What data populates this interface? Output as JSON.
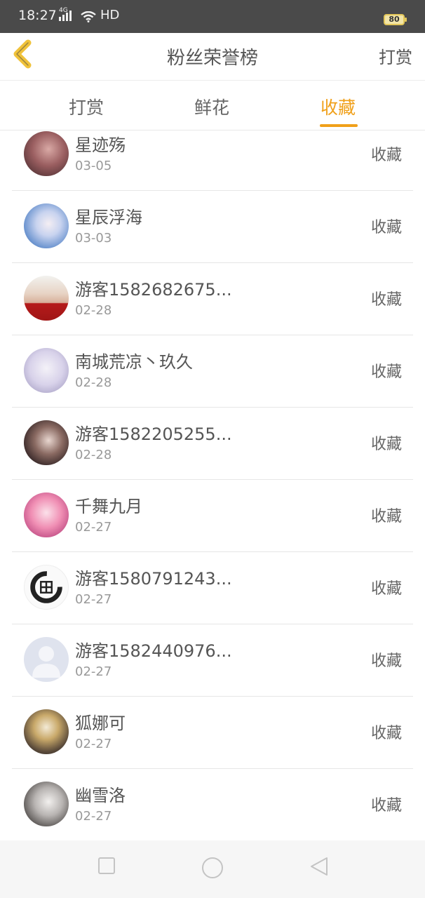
{
  "status_bar": {
    "time": "18:27",
    "network": "4G",
    "hd": "HD",
    "battery": "80"
  },
  "header": {
    "title": "粉丝荣誉榜",
    "action": "打赏"
  },
  "tabs": [
    {
      "label": "打赏",
      "active": false
    },
    {
      "label": "鲜花",
      "active": false
    },
    {
      "label": "收藏",
      "active": true
    }
  ],
  "list": [
    {
      "name": "星迹殇",
      "date": "03-05",
      "action": "收藏",
      "avatar": "portrait-rose"
    },
    {
      "name": "星辰浮海",
      "date": "03-03",
      "action": "收藏",
      "avatar": "portrait-blue"
    },
    {
      "name": "游客1582682675...",
      "date": "02-28",
      "action": "收藏",
      "avatar": "portrait-flag"
    },
    {
      "name": "南城荒凉丶玖久",
      "date": "02-28",
      "action": "收藏",
      "avatar": "portrait-lavender"
    },
    {
      "name": "游客1582205255...",
      "date": "02-28",
      "action": "收藏",
      "avatar": "portrait-dark"
    },
    {
      "name": "千舞九月",
      "date": "02-27",
      "action": "收藏",
      "avatar": "portrait-pink"
    },
    {
      "name": "游客1580791243...",
      "date": "02-27",
      "action": "收藏",
      "avatar": "portrait-ink"
    },
    {
      "name": "游客1582440976...",
      "date": "02-27",
      "action": "收藏",
      "avatar": "default-avatar"
    },
    {
      "name": "狐娜可",
      "date": "02-27",
      "action": "收藏",
      "avatar": "portrait-gold"
    },
    {
      "name": "幽雪洛",
      "date": "02-27",
      "action": "收藏",
      "avatar": "portrait-grey"
    }
  ],
  "colors": {
    "accent": "#f0a01a",
    "status_bar": "#4a4a4a",
    "text": "#555555",
    "subtext": "#999999"
  },
  "nav_bar": {
    "icons": [
      "recent-apps-icon",
      "home-icon",
      "back-icon"
    ]
  }
}
